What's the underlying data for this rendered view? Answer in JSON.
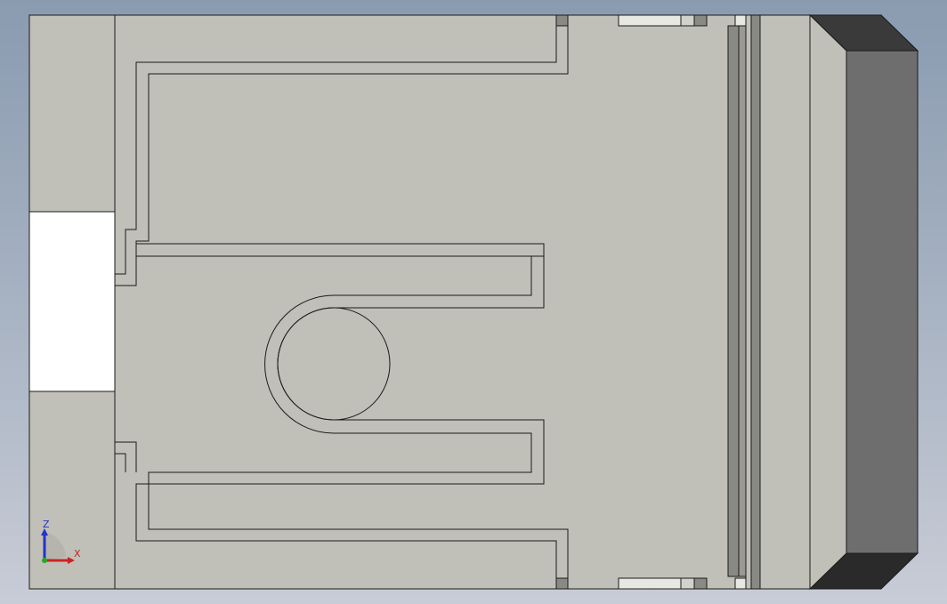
{
  "viewport": {
    "background_top": "#8a9bb0",
    "background_bottom": "#c8ccd6"
  },
  "model": {
    "face_color": "#c0c0b8",
    "edge_color": "#1a1a1a",
    "cutout_color": "#ffffff",
    "shade_dark": "#6e6e6e",
    "shade_darker": "#3a3a3a",
    "shade_mid": "#8a8a84",
    "shade_light": "#d2d2cc"
  },
  "triad": {
    "z_label": "Z",
    "x_label": "X",
    "z_color": "#2233cc",
    "x_color": "#cc2222",
    "origin_color": "#22aa22"
  }
}
